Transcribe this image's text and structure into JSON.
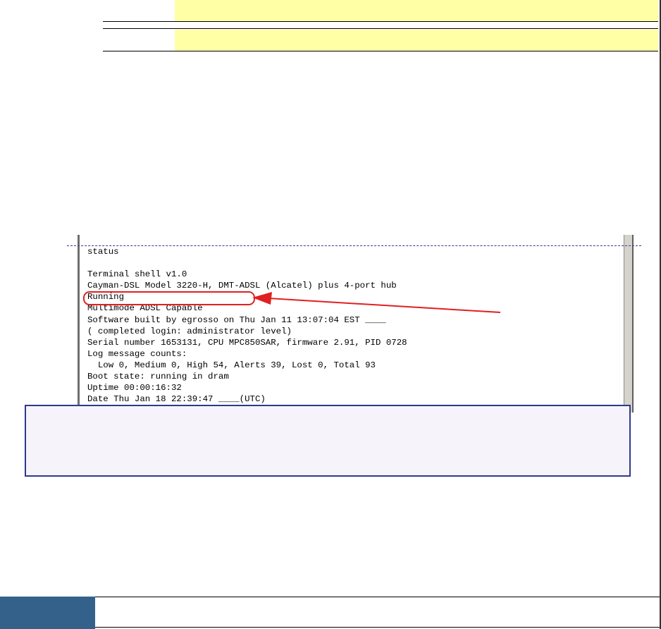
{
  "terminal": {
    "lines": [
      "status",
      "",
      "Terminal shell v1.0",
      "Cayman-DSL Model 3220-H, DMT-ADSL (Alcatel) plus 4-port hub",
      "Running",
      "Multimode ADSL Capable",
      "Software built by egrosso on Thu Jan 11 13:07:04 EST ____",
      "( completed login: administrator level)",
      "Serial number 1653131, CPU MPC850SAR, firmware 2.91, PID 0728",
      "Log message counts:",
      "  Low 0, Medium 0, High 54, Alerts 39, Lost 0, Total 93",
      "Boot state: running in dram",
      "Uptime 00:00:16:32",
      "Date Thu Jan 18 22:39:47 ____(UTC)"
    ]
  },
  "annotation": {
    "highlight_color": "#e02020",
    "arrow_color": "#e02020"
  },
  "colors": {
    "table_highlight": "#ffffa6",
    "info_box_border": "#2e3a8c",
    "info_box_fill": "#f6f3fb",
    "footer_block": "#33618a"
  }
}
